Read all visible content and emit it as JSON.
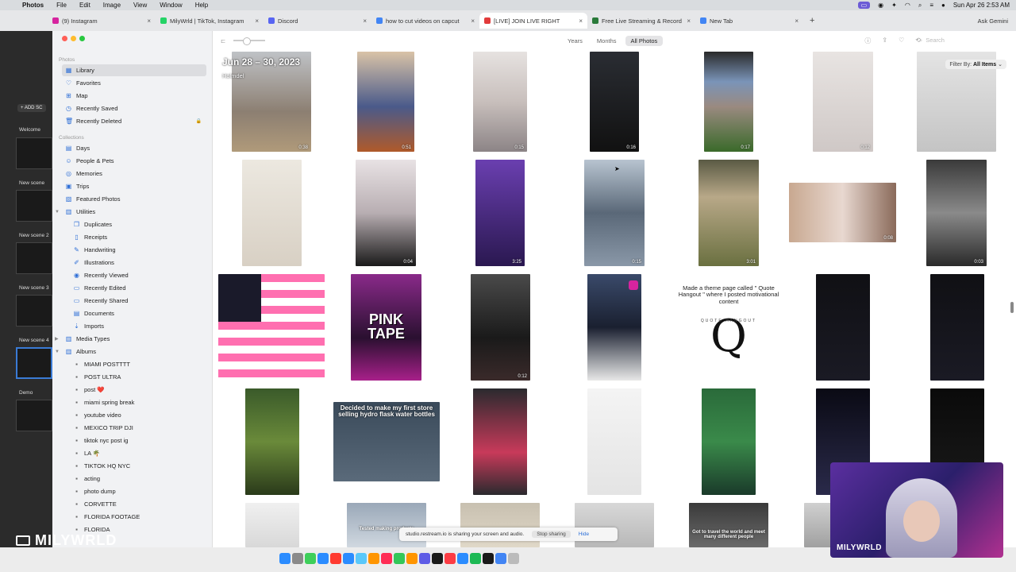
{
  "menubar": {
    "app": "Photos",
    "items": [
      "File",
      "Edit",
      "Image",
      "View",
      "Window",
      "Help"
    ],
    "datetime": "Sun Apr 26  2:53 AM"
  },
  "browser_tabs": [
    {
      "label": "(9) Instagram",
      "color": "#d6249f"
    },
    {
      "label": "MilyWrld | TikTok, Instagram",
      "color": "#25d366"
    },
    {
      "label": "Discord",
      "color": "#5865f2"
    },
    {
      "label": "how to cut videos on capcut",
      "color": "#4285f4"
    },
    {
      "label": "[LIVE] JOIN LIVE RIGHT",
      "color": "#e23b3b",
      "active": true
    },
    {
      "label": "Free Live Streaming & Record",
      "color": "#2a7a3a"
    },
    {
      "label": "New Tab",
      "color": "#4285f4"
    }
  ],
  "ask_gemini": "Ask Gemini",
  "left_panel": {
    "add_button": "+ ADD SC",
    "scenes": [
      "Welcome",
      "New scene",
      "New scene 2",
      "New scene 3",
      "New scene 4",
      "Demo"
    ]
  },
  "sidebar": {
    "section_photos": "Photos",
    "library": [
      "Library",
      "Favorites",
      "Map",
      "Recently Saved",
      "Recently Deleted"
    ],
    "section_collections": "Collections",
    "collections": [
      "Days",
      "People & Pets",
      "Memories",
      "Trips",
      "Featured Photos"
    ],
    "utilities_label": "Utilities",
    "utilities": [
      "Duplicates",
      "Receipts",
      "Handwriting",
      "Illustrations",
      "Recently Viewed",
      "Recently Edited",
      "Recently Shared",
      "Documents",
      "Imports"
    ],
    "media_types": "Media Types",
    "albums_label": "Albums",
    "albums": [
      "MIAMI POSTTTT",
      "POST ULTRA",
      "post ❤️",
      "miami spring break",
      "youtube video",
      "MEXICO TRIP DJI",
      "tiktok nyc post ig",
      "LA 🌴",
      "TIKTOK HQ NYC",
      "acting",
      "photo dump",
      "CORVETTE",
      "FLORIDA FOOTAGE",
      "FLORIDA"
    ]
  },
  "toolbar": {
    "views": [
      "Years",
      "Months",
      "All Photos"
    ],
    "active_view": "All Photos",
    "search_placeholder": "Search"
  },
  "grid": {
    "date_heading": "Jun 28 – 30, 2023",
    "location": "Holmdel",
    "filter_label": "Filter By:",
    "filter_value": "All Items",
    "captions": {
      "c1": "Decided to make my first store selling hydro flask water bottles",
      "c2": "Made a theme page called \" Quote Hangout \" where I posted motivational content",
      "c3": "PINK TAPE",
      "c4": "Got to travel the world and meet many different people",
      "c5": "Tested making products"
    },
    "q_letter": "Q",
    "q_sub": "QUOTE HANGOUT",
    "durations": [
      "0:38",
      "0:51",
      "0:15",
      "0:16",
      "0:17",
      "0:12",
      "0:04",
      "3:25",
      "0:15",
      "3:01",
      "0:08",
      "0:03",
      "0:12"
    ]
  },
  "screen_share": {
    "text": "studio.restream.io is sharing your screen and audio.",
    "stop": "Stop sharing",
    "hide": "Hide"
  },
  "brand": "MILYWRLD",
  "webcam_name": "MILYWRLD"
}
